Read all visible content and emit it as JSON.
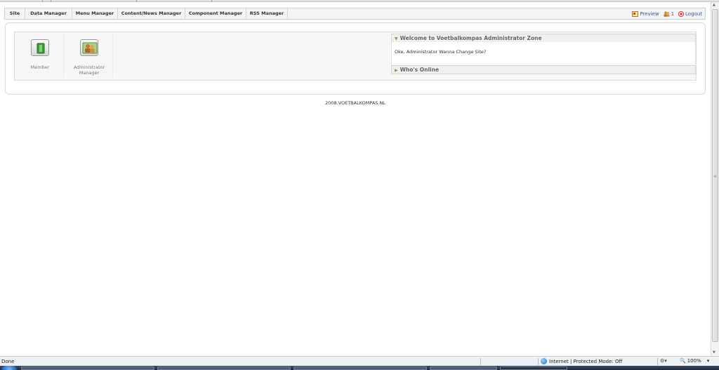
{
  "menu": {
    "items": [
      "Site",
      "Data Manager",
      "Menu Manager",
      "Content/News Manager",
      "Component Manager",
      "RSS Manager"
    ]
  },
  "toolbar": {
    "preview_label": "Preview",
    "user_count": "1",
    "logout_label": "Logout"
  },
  "tiles": [
    {
      "label": "Member",
      "icon": "member-icon"
    },
    {
      "label": "Administrator Manager",
      "icon": "administrator-icon"
    }
  ],
  "welcome": {
    "title": "Welcome to Voetbalkompas Administrator Zone",
    "message": "Oke, Administrator Wanna Change Site?"
  },
  "whos_online": {
    "title": "Who's Online"
  },
  "footer": {
    "copyright": "2008.VOETBALKOMPAS.NL"
  },
  "statusbar": {
    "status": "Done",
    "zone": "Internet | Protected Mode: Off",
    "zoom": "100%"
  },
  "colors": {
    "link": "#2a5db0",
    "accent_arrow": "#6aa84f",
    "panel_bg": "#f7f7f7"
  }
}
